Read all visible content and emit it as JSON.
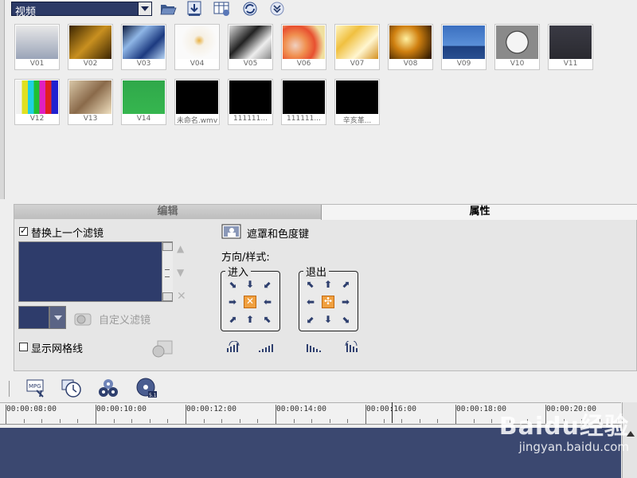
{
  "library": {
    "category_selected": "视频",
    "toolbar_icons": [
      "folder-open-icon",
      "import-video-icon",
      "storyboard-view-icon",
      "refresh-icon",
      "expand-down-icon"
    ]
  },
  "thumbnails": [
    {
      "caption": "V01"
    },
    {
      "caption": "V02"
    },
    {
      "caption": "V03"
    },
    {
      "caption": "V04"
    },
    {
      "caption": "V05"
    },
    {
      "caption": "V06"
    },
    {
      "caption": "V07"
    },
    {
      "caption": "V08"
    },
    {
      "caption": "V09"
    },
    {
      "caption": "V10"
    },
    {
      "caption": "V11"
    },
    {
      "caption": "V12"
    },
    {
      "caption": "V13"
    },
    {
      "caption": "V14"
    },
    {
      "caption": "未命名.wmv"
    },
    {
      "caption": "111111..."
    },
    {
      "caption": "111111..."
    },
    {
      "caption": "辛亥革..."
    }
  ],
  "tabs": {
    "edit": "编辑",
    "properties": "属性"
  },
  "filters": {
    "replace_last_filter": "替换上一个滤镜",
    "replace_checked": true,
    "custom_filter": "自定义滤镜",
    "show_grid": "显示网格线",
    "show_grid_checked": false
  },
  "mask": {
    "label": "遮罩和色度键",
    "direction_style": "方向/样式:",
    "enter_label": "进入",
    "exit_label": "退出"
  },
  "timeline": {
    "ticks": [
      "00:00:08:00",
      "00:00:10:00",
      "00:00:12:00",
      "00:00:14:00",
      "00:00:16:00",
      "00:00:18:00",
      "00:00:20:00"
    ],
    "toolbar_icons": [
      "batch-convert-icon",
      "clock-icon",
      "dvd-auto-icon",
      "disc-icon"
    ]
  },
  "watermark": {
    "logo": "Baidu经验",
    "url": "jingyan.baidu.com"
  }
}
